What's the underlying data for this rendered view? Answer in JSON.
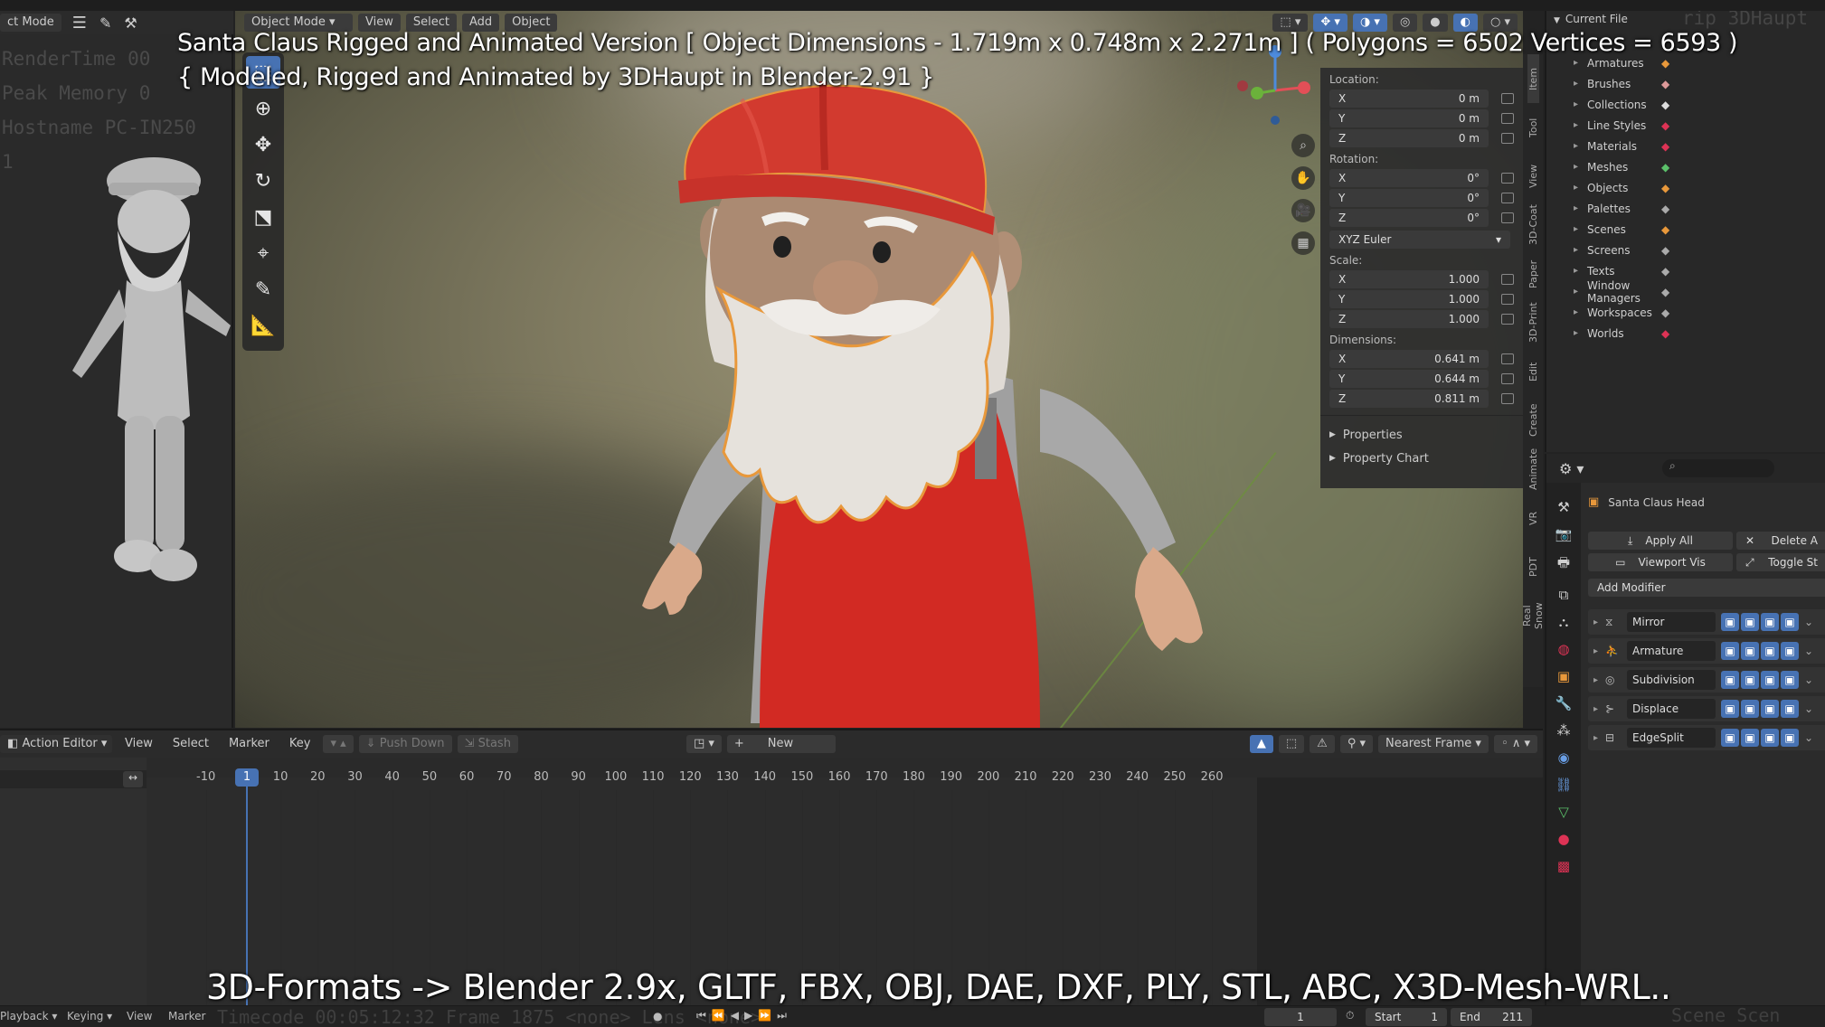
{
  "overlay": {
    "title_line1": "Santa Claus Rigged and Animated Version [ Object Dimensions -  1.719m x 0.748m x 2.271m ] ( Polygons = 6502  Vertices = 6593 )",
    "title_line2": "{ Modeled, Rigged and Animated by 3DHaupt in Blender-2.91 }",
    "formats": "3D-Formats -> Blender 2.9x, GLTF, FBX, OBJ, DAE, DXF, PLY, STL, ABC, X3D-Mesh-WRL.."
  },
  "stats_bg": [
    "RenderTime 00",
    "Peak Memory 0",
    "Hostname PC-IN250",
    "1"
  ],
  "left_header": {
    "mode": "ct Mode"
  },
  "viewport_header": {
    "mode": "Object Mode",
    "menus": [
      "View",
      "Select",
      "Add",
      "Object"
    ]
  },
  "npanel": {
    "location_label": "Location:",
    "location": [
      {
        "axis": "X",
        "value": "0 m"
      },
      {
        "axis": "Y",
        "value": "0 m"
      },
      {
        "axis": "Z",
        "value": "0 m"
      }
    ],
    "rotation_label": "Rotation:",
    "rotation": [
      {
        "axis": "X",
        "value": "0°"
      },
      {
        "axis": "Y",
        "value": "0°"
      },
      {
        "axis": "Z",
        "value": "0°"
      }
    ],
    "rotation_mode": "XYZ Euler",
    "scale_label": "Scale:",
    "scale": [
      {
        "axis": "X",
        "value": "1.000"
      },
      {
        "axis": "Y",
        "value": "1.000"
      },
      {
        "axis": "Z",
        "value": "1.000"
      }
    ],
    "dimensions_label": "Dimensions:",
    "dimensions": [
      {
        "axis": "X",
        "value": "0.641 m"
      },
      {
        "axis": "Y",
        "value": "0.644 m"
      },
      {
        "axis": "Z",
        "value": "0.811 m"
      }
    ],
    "properties": "Properties",
    "property_chart": "Property Chart",
    "tabs": [
      "Item",
      "Tool",
      "View",
      "3D-Coat",
      "Paper",
      "3D-Print",
      "Edit",
      "Create",
      "Animate",
      "VR",
      "PDT",
      "Real Snow"
    ]
  },
  "outliner": {
    "header": "Current File",
    "ghost": "rip 3DHaupt",
    "items": [
      "Armatures",
      "Brushes",
      "Collections",
      "Line Styles",
      "Materials",
      "Meshes",
      "Objects",
      "Palettes",
      "Scenes",
      "Screens",
      "Texts",
      "Window Managers",
      "Workspaces",
      "Worlds"
    ]
  },
  "properties": {
    "object_name": "Santa Claus Head",
    "apply_all": "Apply All",
    "delete_all": "Delete A",
    "viewport_vis": "Viewport Vis",
    "toggle_stack": "Toggle St",
    "add_modifier": "Add Modifier",
    "modifiers": [
      "Mirror",
      "Armature",
      "Subdivision",
      "Displace",
      "EdgeSplit"
    ]
  },
  "action_editor": {
    "mode": "Action Editor",
    "menus": [
      "View",
      "Select",
      "Marker",
      "Key"
    ],
    "push_down": "Push Down",
    "stash": "Stash",
    "new": "New",
    "snap": "Nearest Frame",
    "current_frame": "1",
    "ticks": [
      "-10",
      "1",
      "10",
      "20",
      "30",
      "40",
      "50",
      "60",
      "70",
      "80",
      "90",
      "100",
      "110",
      "120",
      "130",
      "140",
      "150",
      "160",
      "170",
      "180",
      "190",
      "200",
      "210",
      "220",
      "230",
      "240",
      "250",
      "260"
    ]
  },
  "footer": {
    "menus": [
      "Playback",
      "Keying",
      "View",
      "Marker"
    ],
    "ghost": "Timecode 00:05:12:32   Frame 1875   <none>   Lens <none>",
    "frame": "1",
    "start_label": "Start",
    "start": "1",
    "end_label": "End",
    "end": "211",
    "scene": "Scene Scen"
  },
  "colors": {
    "accent": "#4772b3",
    "hat": "#d23a2f",
    "overalls": "#d4271f",
    "selection": "#e8983b"
  }
}
